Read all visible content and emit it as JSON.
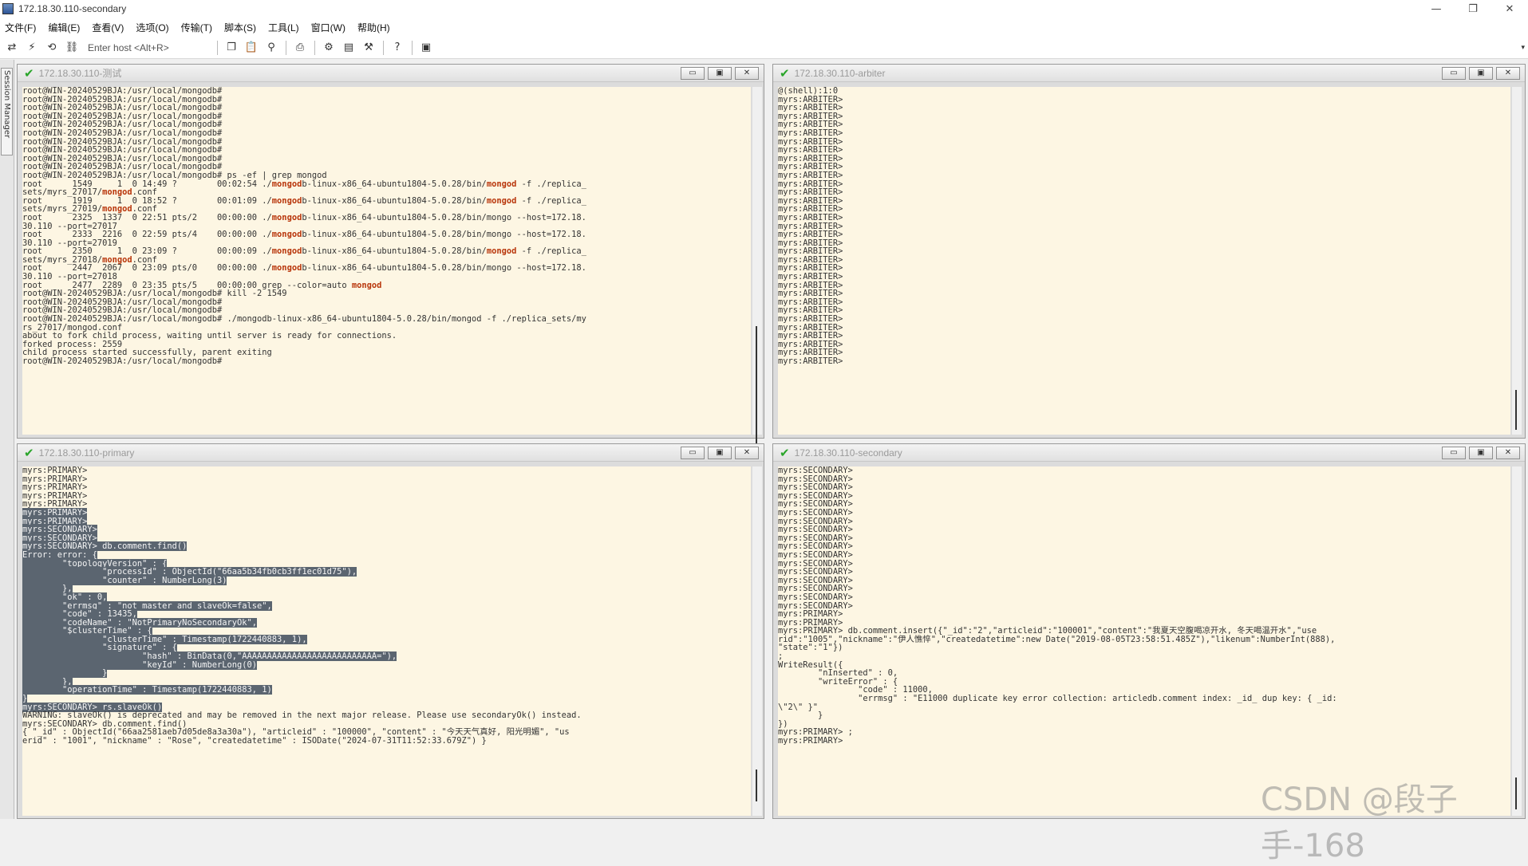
{
  "window": {
    "title": "172.18.30.110-secondary",
    "controls": [
      "—",
      "❐",
      "✕"
    ]
  },
  "menu": [
    "文件(F)",
    "编辑(E)",
    "查看(V)",
    "选项(O)",
    "传输(T)",
    "脚本(S)",
    "工具(L)",
    "窗口(W)",
    "帮助(H)"
  ],
  "toolbar": {
    "host_placeholder": "Enter host <Alt+R>"
  },
  "sidebar": {
    "tab_label": "Session Manager"
  },
  "panes": {
    "tl": {
      "title": "172.18.30.110-测试",
      "check": "✔"
    },
    "tr": {
      "title": "172.18.30.110-arbiter",
      "check": "✔"
    },
    "bl": {
      "title": "172.18.30.110-primary",
      "check": "✔"
    },
    "br": {
      "title": "172.18.30.110-secondary",
      "check": "✔"
    }
  },
  "terminals": {
    "tl": [
      [
        [
          "root@WIN-20240529BJA:/usr/local/mongodb#"
        ]
      ],
      [
        [
          "root@WIN-20240529BJA:/usr/local/mongodb#"
        ]
      ],
      [
        [
          "root@WIN-20240529BJA:/usr/local/mongodb#"
        ]
      ],
      [
        [
          "root@WIN-20240529BJA:/usr/local/mongodb#"
        ]
      ],
      [
        [
          "root@WIN-20240529BJA:/usr/local/mongodb#"
        ]
      ],
      [
        [
          "root@WIN-20240529BJA:/usr/local/mongodb#"
        ]
      ],
      [
        [
          "root@WIN-20240529BJA:/usr/local/mongodb#"
        ]
      ],
      [
        [
          "root@WIN-20240529BJA:/usr/local/mongodb#"
        ]
      ],
      [
        [
          "root@WIN-20240529BJA:/usr/local/mongodb#"
        ]
      ],
      [
        [
          "root@WIN-20240529BJA:/usr/local/mongodb#"
        ]
      ],
      [
        [
          "root@WIN-20240529BJA:/usr/local/mongodb# ps -ef | grep mongod"
        ]
      ],
      [
        [
          "root      1549     1  0 14:49 ?        00:02:54 ./"
        ],
        [
          "mongod",
          "hl"
        ],
        [
          "b-linux-x86_64-ubuntu1804-5.0.28/bin/"
        ],
        [
          "mongod",
          "hl"
        ],
        [
          " -f ./replica_"
        ]
      ],
      [
        [
          "sets/myrs_27017/"
        ],
        [
          "mongod",
          "hl"
        ],
        [
          ".conf"
        ]
      ],
      [
        [
          "root      1919     1  0 18:52 ?        00:01:09 ./"
        ],
        [
          "mongod",
          "hl"
        ],
        [
          "b-linux-x86_64-ubuntu1804-5.0.28/bin/"
        ],
        [
          "mongod",
          "hl"
        ],
        [
          " -f ./replica_"
        ]
      ],
      [
        [
          "sets/myrs_27019/"
        ],
        [
          "mongod",
          "hl"
        ],
        [
          ".conf"
        ]
      ],
      [
        [
          "root      2325  1337  0 22:51 pts/2    00:00:00 ./"
        ],
        [
          "mongod",
          "hl"
        ],
        [
          "b-linux-x86_64-ubuntu1804-5.0.28/bin/mongo --host=172.18."
        ]
      ],
      [
        [
          "30.110 --port=27017"
        ]
      ],
      [
        [
          "root      2333  2216  0 22:59 pts/4    00:00:00 ./"
        ],
        [
          "mongod",
          "hl"
        ],
        [
          "b-linux-x86_64-ubuntu1804-5.0.28/bin/mongo --host=172.18."
        ]
      ],
      [
        [
          "30.110 --port=27019"
        ]
      ],
      [
        [
          "root      2350     1  0 23:09 ?        00:00:09 ./"
        ],
        [
          "mongod",
          "hl"
        ],
        [
          "b-linux-x86_64-ubuntu1804-5.0.28/bin/"
        ],
        [
          "mongod",
          "hl"
        ],
        [
          " -f ./replica_"
        ]
      ],
      [
        [
          "sets/myrs_27018/"
        ],
        [
          "mongod",
          "hl"
        ],
        [
          ".conf"
        ]
      ],
      [
        [
          "root      2447  2067  0 23:09 pts/0    00:00:00 ./"
        ],
        [
          "mongod",
          "hl"
        ],
        [
          "b-linux-x86_64-ubuntu1804-5.0.28/bin/mongo --host=172.18."
        ]
      ],
      [
        [
          "30.110 --port=27018"
        ]
      ],
      [
        [
          "root      2477  2289  0 23:35 pts/5    00:00:00 grep --color=auto "
        ],
        [
          "mongod",
          "hl"
        ]
      ],
      [
        [
          "root@WIN-20240529BJA:/usr/local/mongodb# kill -2 1549"
        ]
      ],
      [
        [
          "root@WIN-20240529BJA:/usr/local/mongodb#"
        ]
      ],
      [
        [
          "root@WIN-20240529BJA:/usr/local/mongodb#"
        ]
      ],
      [
        [
          "root@WIN-20240529BJA:/usr/local/mongodb# ./mongodb-linux-x86_64-ubuntu1804-5.0.28/bin/mongod -f ./replica_sets/my"
        ]
      ],
      [
        [
          "rs_27017/mongod.conf"
        ]
      ],
      [
        [
          "about to fork child process, waiting until server is ready for connections."
        ]
      ],
      [
        [
          "forked process: 2559"
        ]
      ],
      [
        [
          "child process started successfully, parent exiting"
        ]
      ],
      [
        [
          "root@WIN-20240529BJA:/usr/local/mongodb#"
        ]
      ]
    ],
    "tr": [
      [
        [
          "@(shell):1:0"
        ]
      ],
      [
        [
          "myrs:ARBITER>"
        ]
      ],
      [
        [
          "myrs:ARBITER>"
        ]
      ],
      [
        [
          "myrs:ARBITER>"
        ]
      ],
      [
        [
          "myrs:ARBITER>"
        ]
      ],
      [
        [
          "myrs:ARBITER>"
        ]
      ],
      [
        [
          "myrs:ARBITER>"
        ]
      ],
      [
        [
          "myrs:ARBITER>"
        ]
      ],
      [
        [
          "myrs:ARBITER>"
        ]
      ],
      [
        [
          "myrs:ARBITER>"
        ]
      ],
      [
        [
          "myrs:ARBITER>"
        ]
      ],
      [
        [
          "myrs:ARBITER>"
        ]
      ],
      [
        [
          "myrs:ARBITER>"
        ]
      ],
      [
        [
          "myrs:ARBITER>"
        ]
      ],
      [
        [
          "myrs:ARBITER>"
        ]
      ],
      [
        [
          "myrs:ARBITER>"
        ]
      ],
      [
        [
          "myrs:ARBITER>"
        ]
      ],
      [
        [
          "myrs:ARBITER>"
        ]
      ],
      [
        [
          "myrs:ARBITER>"
        ]
      ],
      [
        [
          "myrs:ARBITER>"
        ]
      ],
      [
        [
          "myrs:ARBITER>"
        ]
      ],
      [
        [
          "myrs:ARBITER>"
        ]
      ],
      [
        [
          "myrs:ARBITER>"
        ]
      ],
      [
        [
          "myrs:ARBITER>"
        ]
      ],
      [
        [
          "myrs:ARBITER>"
        ]
      ],
      [
        [
          "myrs:ARBITER>"
        ]
      ],
      [
        [
          "myrs:ARBITER>"
        ]
      ],
      [
        [
          "myrs:ARBITER>"
        ]
      ],
      [
        [
          "myrs:ARBITER>"
        ]
      ],
      [
        [
          "myrs:ARBITER>"
        ]
      ],
      [
        [
          "myrs:ARBITER>"
        ]
      ],
      [
        [
          "myrs:ARBITER>"
        ]
      ],
      [
        [
          "myrs:ARBITER>"
        ]
      ]
    ],
    "bl": [
      [
        [
          "myrs:PRIMARY>"
        ]
      ],
      [
        [
          "myrs:PRIMARY>"
        ]
      ],
      [
        [
          "myrs:PRIMARY>"
        ]
      ],
      [
        [
          "myrs:PRIMARY>"
        ]
      ],
      [
        [
          "myrs:PRIMARY>"
        ]
      ],
      [
        [
          "myrs:PRIMARY>",
          "sel"
        ]
      ],
      [
        [
          "myrs:PRIMARY>",
          "sel"
        ]
      ],
      [
        [
          "myrs:SECONDARY>",
          "sel"
        ]
      ],
      [
        [
          "myrs:SECONDARY>",
          "sel"
        ]
      ],
      [
        [
          "myrs:SECONDARY> db.comment.find()",
          "sel"
        ]
      ],
      [
        [
          "Error: error: {",
          "sel"
        ]
      ],
      [
        [
          "        \"topologyVersion\" : {",
          "sel"
        ]
      ],
      [
        [
          "                \"processId\" : ObjectId(\"66aa5b34fb0cb3ff1ec01d75\"),",
          "sel"
        ]
      ],
      [
        [
          "                \"counter\" : NumberLong(3)",
          "sel"
        ]
      ],
      [
        [
          "        },",
          "sel"
        ]
      ],
      [
        [
          "        \"ok\" : 0,",
          "sel"
        ]
      ],
      [
        [
          "        \"errmsg\" : \"not master and slaveOk=false\",",
          "sel"
        ]
      ],
      [
        [
          "        \"code\" : 13435,",
          "sel"
        ]
      ],
      [
        [
          "        \"codeName\" : \"NotPrimaryNoSecondaryOk\",",
          "sel"
        ]
      ],
      [
        [
          "        \"$clusterTime\" : {",
          "sel"
        ]
      ],
      [
        [
          "                \"clusterTime\" : Timestamp(1722440883, 1),",
          "sel"
        ]
      ],
      [
        [
          "                \"signature\" : {",
          "sel"
        ]
      ],
      [
        [
          "                        \"hash\" : BinData(0,\"AAAAAAAAAAAAAAAAAAAAAAAAAAA=\"),",
          "sel"
        ]
      ],
      [
        [
          "                        \"keyId\" : NumberLong(0)",
          "sel"
        ]
      ],
      [
        [
          "                }",
          "sel"
        ]
      ],
      [
        [
          "        },",
          "sel"
        ]
      ],
      [
        [
          "        \"operationTime\" : Timestamp(1722440883, 1)",
          "sel"
        ]
      ],
      [
        [
          "}",
          "sel"
        ]
      ],
      [
        [
          "myrs:SECONDARY> rs.slaveOk()",
          "sel"
        ]
      ],
      [
        [
          "WARNING: slaveOk() is deprecated and may be removed in the next major release. Please use secondaryOk() instead."
        ]
      ],
      [
        [
          "myrs:SECONDARY> db.comment.find()"
        ]
      ],
      [
        [
          "{ \"_id\" : ObjectId(\"66aa2581aeb7d05de8a3a30a\"), \"articleid\" : \"100000\", \"content\" : \"今天天气真好, 阳光明媚\", \"us"
        ]
      ],
      [
        [
          "erid\" : \"1001\", \"nickname\" : \"Rose\", \"createdatetime\" : ISODate(\"2024-07-31T11:52:33.679Z\") }"
        ]
      ]
    ],
    "br": [
      [
        [
          "myrs:SECONDARY>"
        ]
      ],
      [
        [
          "myrs:SECONDARY>"
        ]
      ],
      [
        [
          "myrs:SECONDARY>"
        ]
      ],
      [
        [
          "myrs:SECONDARY>"
        ]
      ],
      [
        [
          "myrs:SECONDARY>"
        ]
      ],
      [
        [
          "myrs:SECONDARY>"
        ]
      ],
      [
        [
          "myrs:SECONDARY>"
        ]
      ],
      [
        [
          "myrs:SECONDARY>"
        ]
      ],
      [
        [
          "myrs:SECONDARY>"
        ]
      ],
      [
        [
          "myrs:SECONDARY>"
        ]
      ],
      [
        [
          "myrs:SECONDARY>"
        ]
      ],
      [
        [
          "myrs:SECONDARY>"
        ]
      ],
      [
        [
          "myrs:SECONDARY>"
        ]
      ],
      [
        [
          "myrs:SECONDARY>"
        ]
      ],
      [
        [
          "myrs:SECONDARY>"
        ]
      ],
      [
        [
          "myrs:SECONDARY>"
        ]
      ],
      [
        [
          "myrs:SECONDARY>"
        ]
      ],
      [
        [
          "myrs:PRIMARY>"
        ]
      ],
      [
        [
          "myrs:PRIMARY>"
        ]
      ],
      [
        [
          "myrs:PRIMARY> db.comment.insert({\"_id\":\"2\",\"articleid\":\"100001\",\"content\":\"我夏天空腹喝凉开水, 冬天喝温开水\",\"use"
        ]
      ],
      [
        [
          "rid\":\"1005\",\"nickname\":\"伊人憔悴\",\"createdatetime\":new Date(\"2019-08-05T23:58:51.485Z\"),\"likenum\":NumberInt(888),"
        ]
      ],
      [
        [
          "\"state\":\"1\"})"
        ]
      ],
      [
        [
          ";"
        ]
      ],
      [
        [
          "WriteResult({"
        ]
      ],
      [
        [
          "        \"nInserted\" : 0,"
        ]
      ],
      [
        [
          "        \"writeError\" : {"
        ]
      ],
      [
        [
          "                \"code\" : 11000,"
        ]
      ],
      [
        [
          "                \"errmsg\" : \"E11000 duplicate key error collection: articledb.comment index: _id_ dup key: { _id:"
        ]
      ],
      [
        [
          "\\\"2\\\" }\""
        ]
      ],
      [
        [
          "        }"
        ]
      ],
      [
        [
          "})"
        ]
      ],
      [
        [
          "myrs:PRIMARY> ;"
        ]
      ],
      [
        [
          "myrs:PRIMARY>"
        ]
      ]
    ]
  },
  "watermark": "CSDN @段子手-168"
}
